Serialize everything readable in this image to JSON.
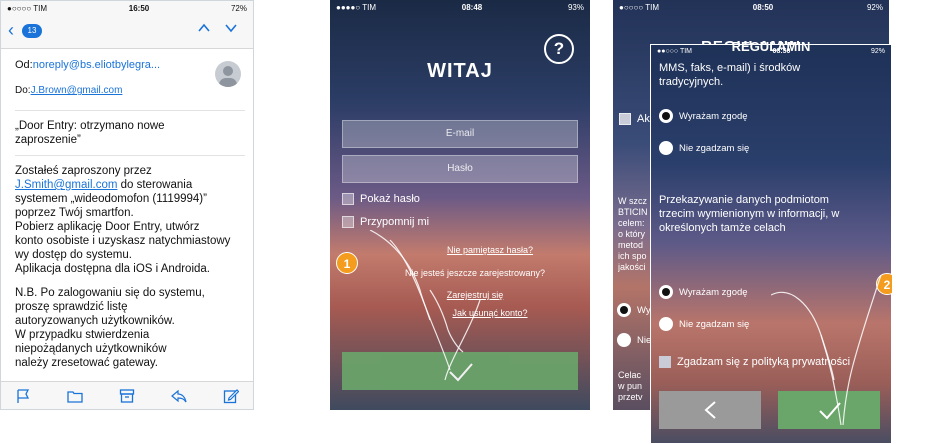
{
  "mail_screen": {
    "status": {
      "carrier": "●○○○○ TIM",
      "time": "16:50",
      "battery": "72%"
    },
    "nav": {
      "back_count": "13"
    },
    "from_label": "Od:",
    "from_value": "noreply@bs.eliotbylegra...",
    "to_label": "Do:",
    "to_value": "J.Brown@gmail.com",
    "subject_lines": [
      "„Door Entry: otrzymano nowe",
      "zaproszenie”"
    ],
    "body_1": "Zostałeś zaproszony przez",
    "body_link": "J.Smith@gmail.com",
    "body_2": " do sterowania",
    "body_3": "systemem „wideodomofon (1119994)”",
    "body_4": "poprzez Twój smartfon.",
    "body_5": "Pobierz aplikację Door Entry, utwórz",
    "body_6": "konto osobiste i uzyskasz natychmiastowy",
    "body_7": "wy dostęp do systemu.",
    "body_8": "Aplikacja dostępna dla iOS i Androida.",
    "body_9": "N.B. Po zalogowaniu się do systemu,",
    "body_10": "proszę sprawdzić listę",
    "body_11": "autoryzowanych użytkowników.",
    "body_12": "W przypadku stwierdzenia",
    "body_13": "niepożądanych użytkowników",
    "body_14": "należy zresetować gateway."
  },
  "login_screen": {
    "status": {
      "carrier": "●●●●○ TIM",
      "time": "08:48",
      "battery": "93%"
    },
    "help": "?",
    "title": "WITAJ",
    "email_placeholder": "E-mail",
    "password_placeholder": "Hasło",
    "show_password": "Pokaż hasło",
    "remember_me": "Przypomnij mi",
    "forgot_password": "Nie pamiętasz hasła?",
    "not_registered": "Nie jesteś jeszcze zarejestrowany?",
    "register": "Zarejestruj się",
    "delete_account": "Jak usunąć konto?",
    "step_marker": "1",
    "confirm_icon": "check-icon"
  },
  "regulations_screen": {
    "back": {
      "status": {
        "carrier": "●○○○○ TIM",
        "time": "08:50",
        "battery": "92%"
      },
      "title": "REGULAMIN",
      "accept_label": "Ak",
      "text_lines": [
        "W szcz",
        "BTICIN",
        "celem:",
        "o który",
        "metod",
        "ich spo",
        "jakości"
      ],
      "radio_1": "Wy",
      "radio_2": "Nie",
      "bottom_lines": [
        "Celac",
        "w pun",
        "przetv"
      ]
    },
    "front": {
      "status": {
        "carrier": "●●○○○ TIM",
        "time": "08:50",
        "battery": "92%"
      },
      "title": "REGULAMIN",
      "top_text": [
        "MMS, faks, e-mail) i środków",
        "tradycyjnych."
      ],
      "consent_1_yes": "Wyrażam zgodę",
      "consent_1_no": "Nie zgadzam się",
      "third_party_text": [
        "Przekazywanie danych podmiotom",
        "trzecim wymienionym w informacji, w",
        "określonych tamże celach"
      ],
      "consent_2_yes": "Wyrażam zgodę",
      "consent_2_no": "Nie zgadzam się",
      "agree_policy": "Zgadzam się z polityką prywatności",
      "step_marker": "2",
      "back_icon": "chevron-left-icon",
      "ok_icon": "check-icon"
    }
  },
  "colors": {
    "accent_blue": "#1a73d9",
    "confirm_green": "#6aa56a",
    "step_orange": "#f39c1e"
  }
}
